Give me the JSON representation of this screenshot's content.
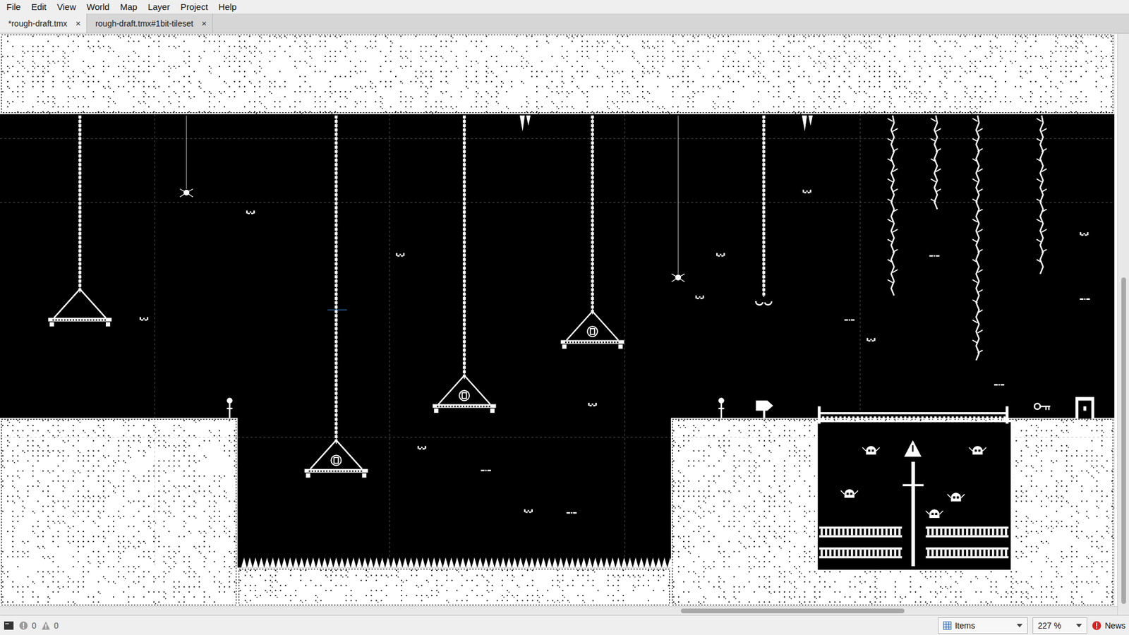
{
  "menu": [
    "File",
    "Edit",
    "View",
    "World",
    "Map",
    "Layer",
    "Project",
    "Help"
  ],
  "tabs": [
    {
      "label": "*rough-draft.tmx",
      "selected": true,
      "close": "×"
    },
    {
      "label": "rough-draft.tmx#1bit-tileset",
      "selected": false,
      "close": "×"
    }
  ],
  "status_bar": {
    "errors": "0",
    "warnings": "0",
    "layer": "Items",
    "zoom": "227 %",
    "news": "News"
  }
}
